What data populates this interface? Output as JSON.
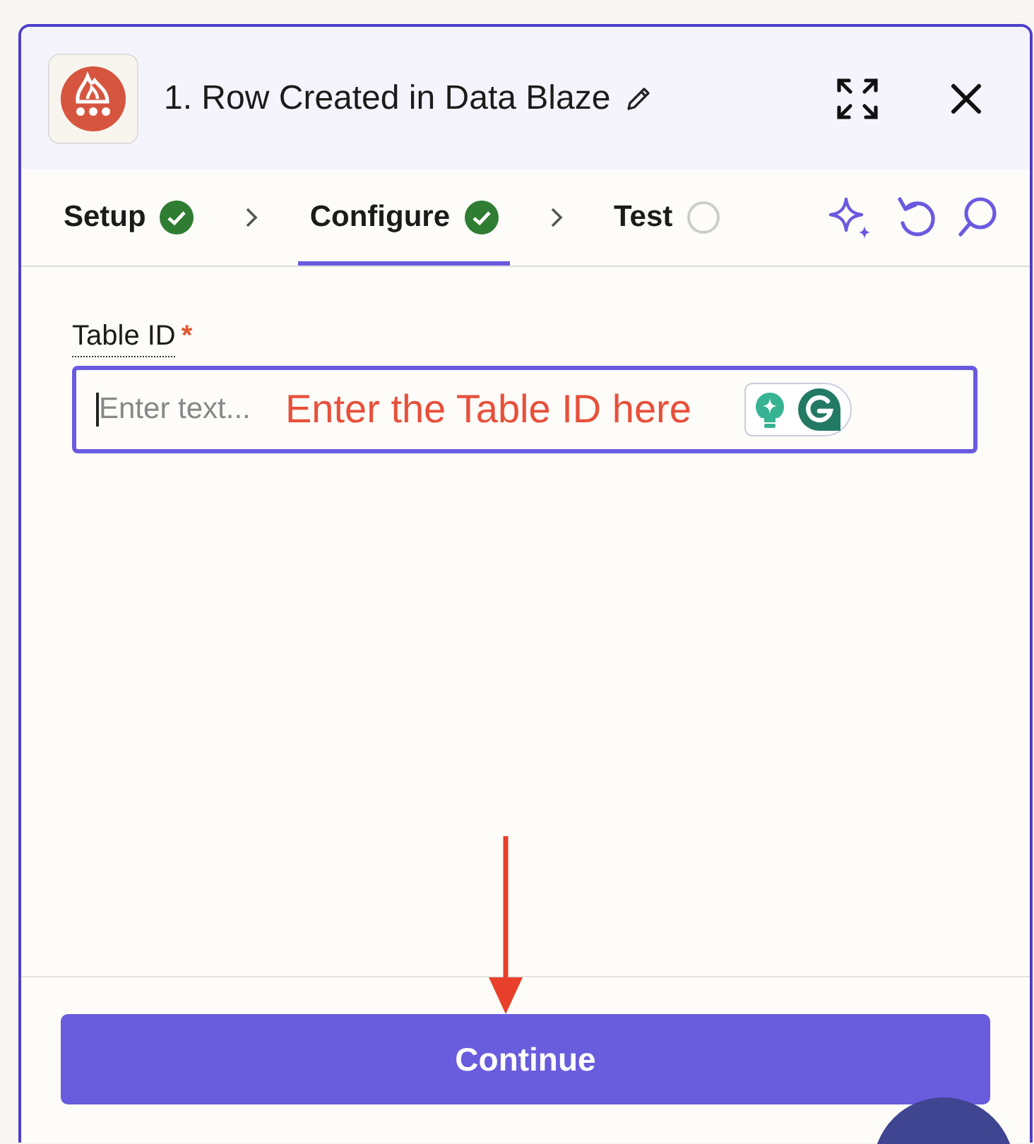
{
  "panel": {
    "title": "1. Row Created in Data Blaze"
  },
  "tabs": [
    {
      "label": "Setup",
      "selected": false,
      "complete": true
    },
    {
      "label": "Configure",
      "selected": true,
      "complete": true
    },
    {
      "label": "Test",
      "selected": false,
      "complete": false
    }
  ],
  "field": {
    "label": "Table ID",
    "required": true,
    "required_mark": "*",
    "placeholder": "Enter text..."
  },
  "annotation": {
    "text": "Enter the Table ID here"
  },
  "footer": {
    "button": "Continue"
  }
}
